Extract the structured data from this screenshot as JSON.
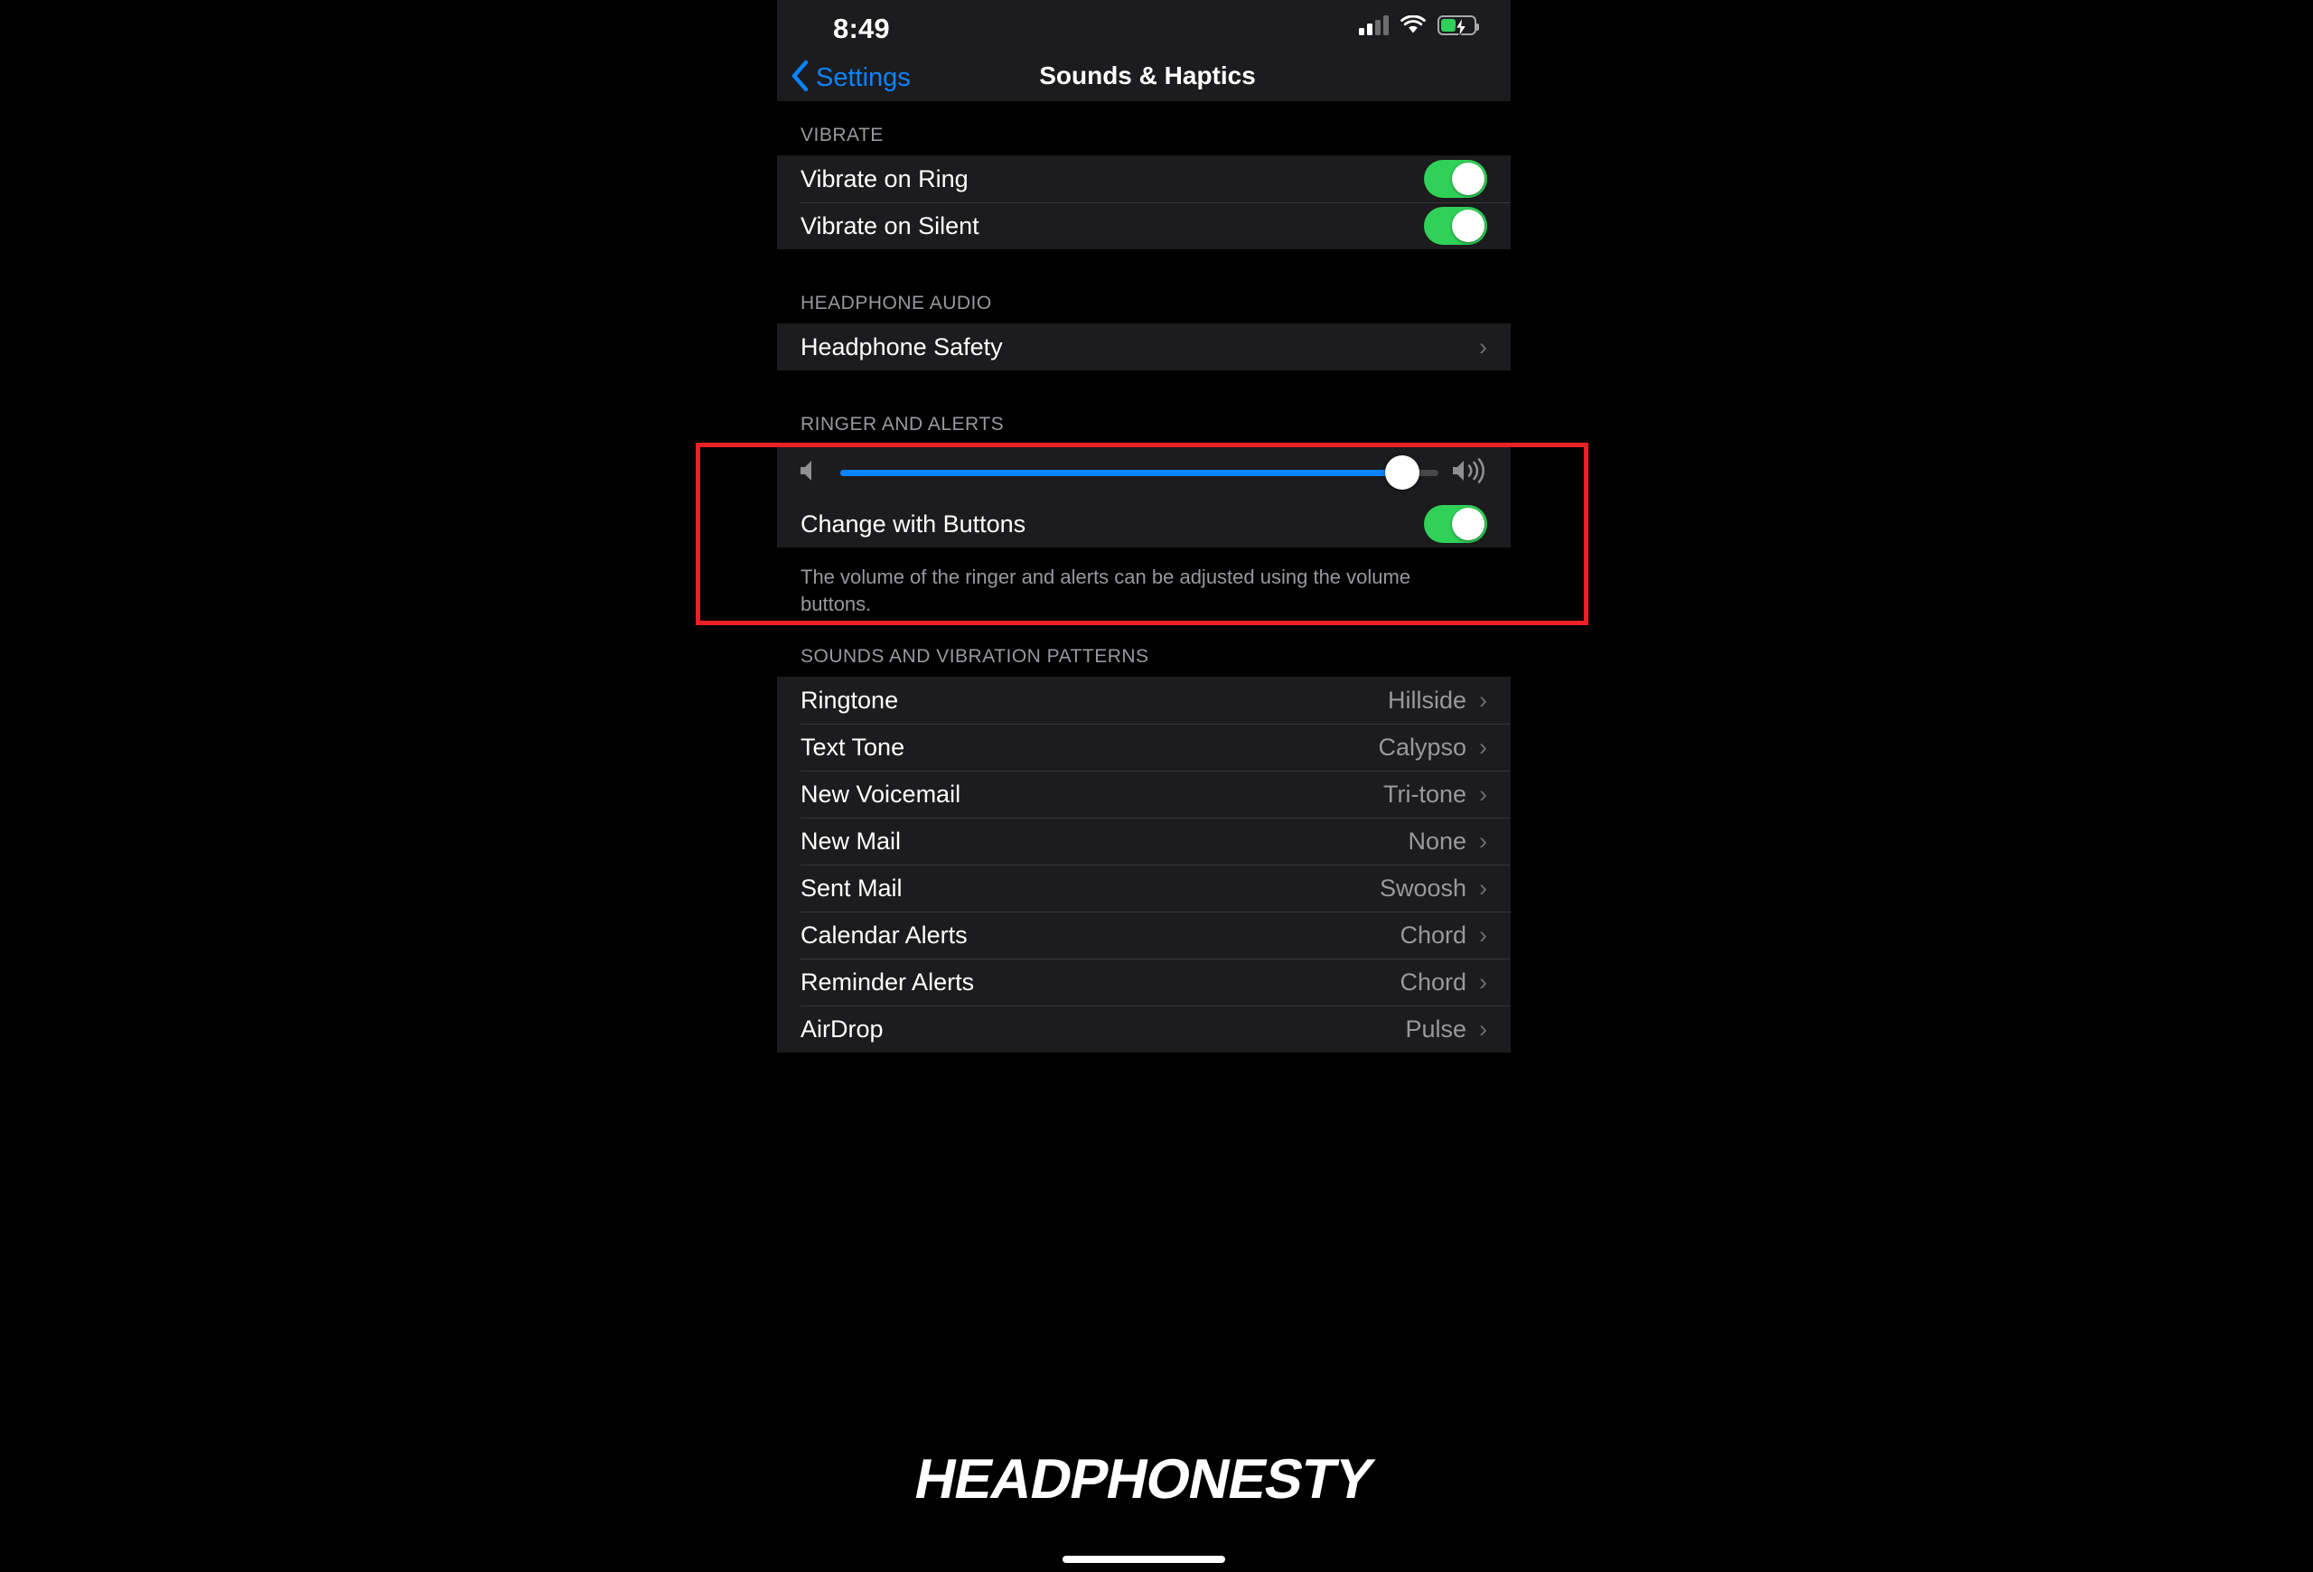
{
  "status_bar": {
    "time": "8:49",
    "signal_icon": "cellular-signal-icon",
    "wifi_icon": "wifi-icon",
    "battery_icon": "battery-charging-icon"
  },
  "nav": {
    "back_label": "Settings",
    "back_icon": "chevron-left-icon",
    "title": "Sounds & Haptics"
  },
  "sections": {
    "vibrate": {
      "header": "VIBRATE",
      "rows": [
        {
          "label": "Vibrate on Ring",
          "control": "toggle",
          "value": "on"
        },
        {
          "label": "Vibrate on Silent",
          "control": "toggle",
          "value": "on"
        }
      ]
    },
    "headphone_audio": {
      "header": "HEADPHONE AUDIO",
      "rows": [
        {
          "label": "Headphone Safety",
          "control": "disclosure",
          "chevron": "›"
        }
      ],
      "highlighted": true,
      "highlight_color": "#ec2027"
    },
    "ringer_and_alerts": {
      "header": "RINGER AND ALERTS",
      "slider": {
        "left_icon": "speaker-low-icon",
        "right_icon": "speaker-high-icon",
        "value_percent": 94,
        "accent_color": "#0a84ff"
      },
      "rows": [
        {
          "label": "Change with Buttons",
          "control": "toggle",
          "value": "on"
        }
      ],
      "footnote": "The volume of the ringer and alerts can be adjusted using the volume buttons."
    },
    "sounds_and_vibration_patterns": {
      "header": "SOUNDS AND VIBRATION PATTERNS",
      "rows": [
        {
          "label": "Ringtone",
          "value": "Hillside",
          "chevron": "›"
        },
        {
          "label": "Text Tone",
          "value": "Calypso",
          "chevron": "›"
        },
        {
          "label": "New Voicemail",
          "value": "Tri-tone",
          "chevron": "›"
        },
        {
          "label": "New Mail",
          "value": "None",
          "chevron": "›"
        },
        {
          "label": "Sent Mail",
          "value": "Swoosh",
          "chevron": "›"
        },
        {
          "label": "Calendar Alerts",
          "value": "Chord",
          "chevron": "›"
        },
        {
          "label": "Reminder Alerts",
          "value": "Chord",
          "chevron": "›"
        },
        {
          "label": "AirDrop",
          "value": "Pulse",
          "chevron": "›"
        }
      ]
    }
  },
  "watermark": {
    "text": "HEADPHONESTY"
  },
  "colors": {
    "background": "#000000",
    "group_background": "#1c1c1e",
    "accent_blue": "#0a84ff",
    "toggle_green": "#30d158",
    "secondary_text": "#98989f",
    "highlight_red": "#ec2027"
  }
}
